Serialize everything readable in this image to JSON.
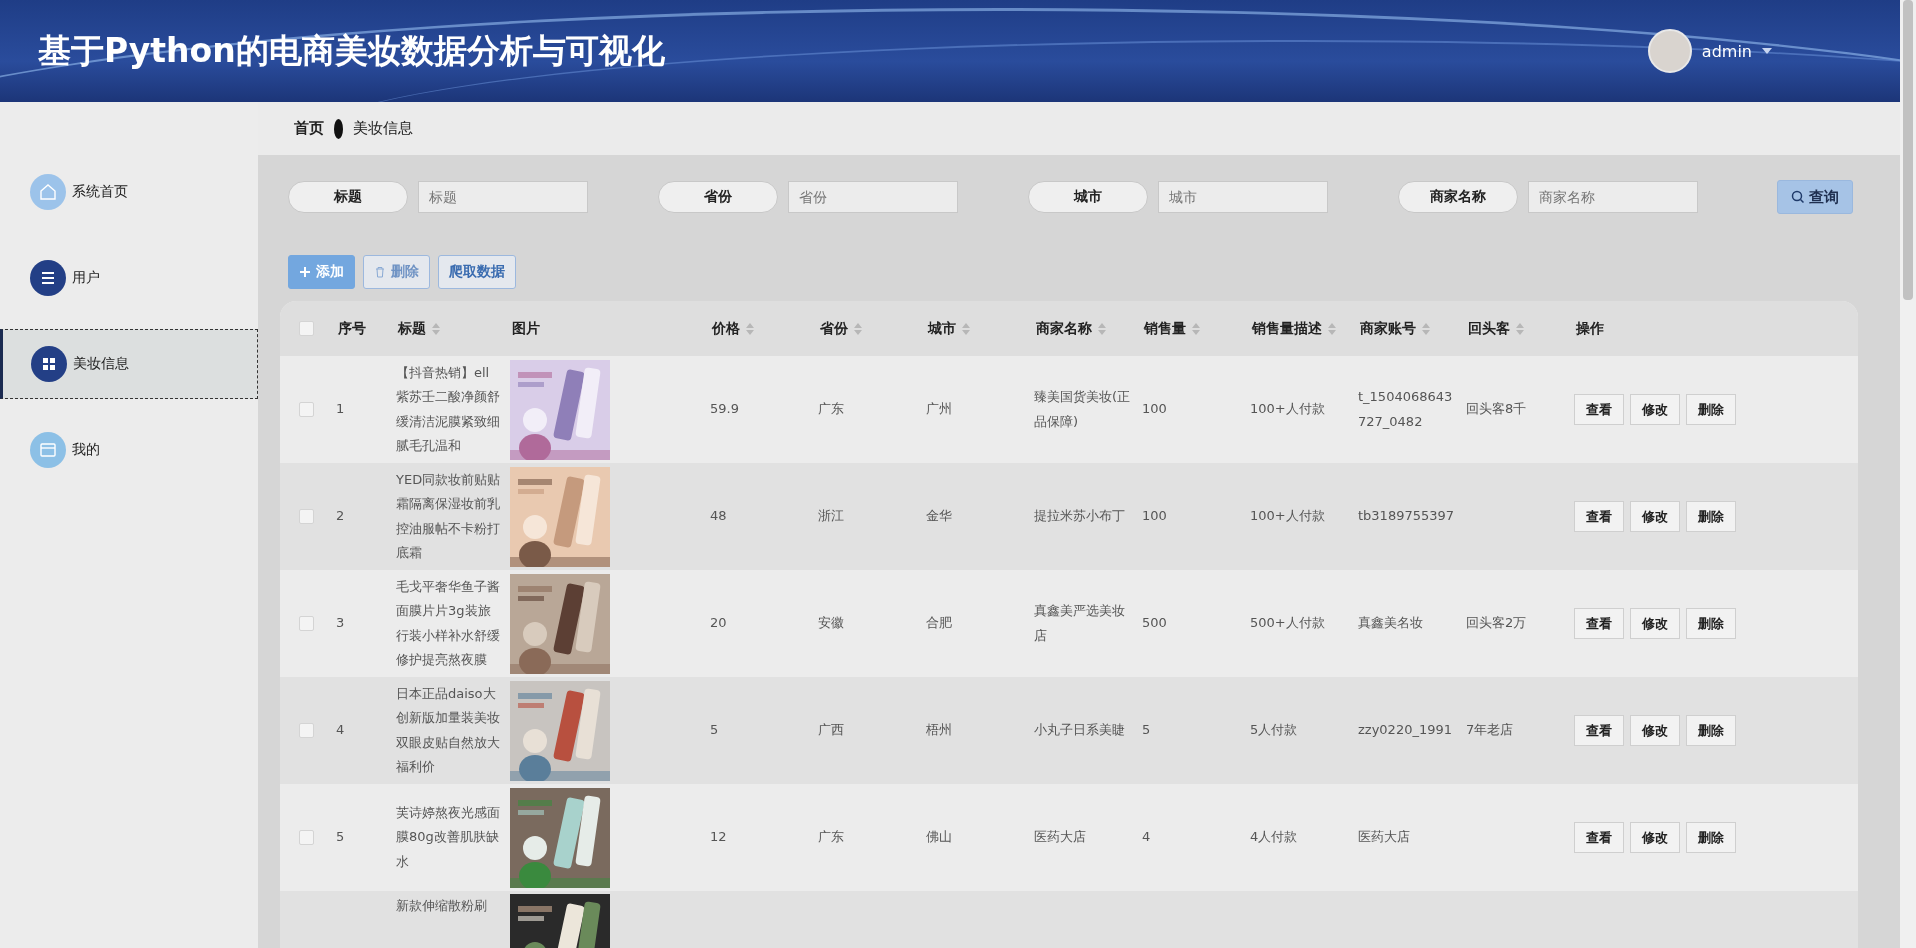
{
  "header": {
    "title": "基于Python的电商美妆数据分析与可视化",
    "user": "admin"
  },
  "breadcrumb": [
    "首页",
    "美妆信息"
  ],
  "sidebar": {
    "items": [
      {
        "label": "系统首页",
        "color": "#9cc3ea",
        "selected": false
      },
      {
        "label": "用户",
        "color": "#233f86",
        "selected": false
      },
      {
        "label": "美妆信息",
        "color": "#233f86",
        "selected": true
      },
      {
        "label": "我的",
        "color": "#8cc0e6",
        "selected": false
      }
    ]
  },
  "search": {
    "fields": [
      {
        "label": "标题",
        "placeholder": "标题"
      },
      {
        "label": "省份",
        "placeholder": "省份"
      },
      {
        "label": "城市",
        "placeholder": "城市"
      },
      {
        "label": "商家名称",
        "placeholder": "商家名称"
      }
    ],
    "button": "查询"
  },
  "actions": [
    {
      "label": "添加",
      "kind": "primary",
      "disabled": false
    },
    {
      "label": "删除",
      "kind": "danger",
      "disabled": true
    },
    {
      "label": "爬取数据",
      "kind": "plain",
      "disabled": false
    }
  ],
  "table": {
    "select_all_checked": false,
    "columns": [
      {
        "label": "序号",
        "sortable": false
      },
      {
        "label": "标题",
        "sortable": true
      },
      {
        "label": "图片",
        "sortable": false
      },
      {
        "label": "价格",
        "sortable": true
      },
      {
        "label": "省份",
        "sortable": true
      },
      {
        "label": "城市",
        "sortable": true
      },
      {
        "label": "商家名称",
        "sortable": true
      },
      {
        "label": "销售量",
        "sortable": true
      },
      {
        "label": "销售量描述",
        "sortable": true
      },
      {
        "label": "商家账号",
        "sortable": true
      },
      {
        "label": "回头客",
        "sortable": true
      },
      {
        "label": "操作",
        "sortable": false
      }
    ],
    "rows": [
      {
        "checked": false,
        "cells": [
          "1",
          "【抖音热销】ell紫苏壬二酸净颜舒缓清洁泥膜紧致细腻毛孔温和",
          {
            "kind": "picture"
          },
          "59.9",
          "广东",
          "广州",
          "臻美国货美妆(正品保障)",
          "100",
          "100+人付款",
          "t_1504068643727_0482",
          "回头客8千"
        ],
        "actions": [
          "查看",
          "修改",
          "删除"
        ]
      },
      {
        "checked": false,
        "cells": [
          "2",
          "YED同款妆前贴贴霜隔离保湿妆前乳控油服帖不卡粉打底霜",
          {
            "kind": "picture"
          },
          "48",
          "浙江",
          "金华",
          "提拉米苏小布丁",
          "100",
          "100+人付款",
          "tb3189755397",
          ""
        ],
        "actions": [
          "查看",
          "修改",
          "删除"
        ]
      },
      {
        "checked": false,
        "cells": [
          "3",
          "毛戈平奢华鱼子酱面膜片片3g装旅行装小样补水舒缓修护提亮熬夜膜",
          {
            "kind": "picture"
          },
          "20",
          "安徽",
          "合肥",
          "真鑫美严选美妆店",
          "500",
          "500+人付款",
          "真鑫美名妆",
          "回头客2万"
        ],
        "actions": [
          "查看",
          "修改",
          "删除"
        ]
      },
      {
        "checked": false,
        "cells": [
          "4",
          "日本正品daiso大创新版加量装美妆双眼皮贴自然放大福利价",
          {
            "kind": "picture"
          },
          "5",
          "广西",
          "梧州",
          "小丸子日系美睫",
          "5",
          "5人付款",
          "zzy0220_1991",
          "7年老店"
        ],
        "actions": [
          "查看",
          "修改",
          "删除"
        ]
      },
      {
        "checked": false,
        "cells": [
          "5",
          "芙诗婷熬夜光感面膜80g改善肌肤缺水",
          {
            "kind": "picture"
          },
          "12",
          "广东",
          "佛山",
          "医药大店",
          "4",
          "4人付款",
          "医药大店",
          ""
        ],
        "actions": [
          "查看",
          "修改",
          "删除"
        ]
      },
      {
        "cells": [
          "",
          "新款伸缩散粉刷",
          {
            "kind": "picture"
          },
          "",
          "",
          "",
          "",
          "",
          "",
          "",
          ""
        ],
        "actions": []
      }
    ]
  }
}
